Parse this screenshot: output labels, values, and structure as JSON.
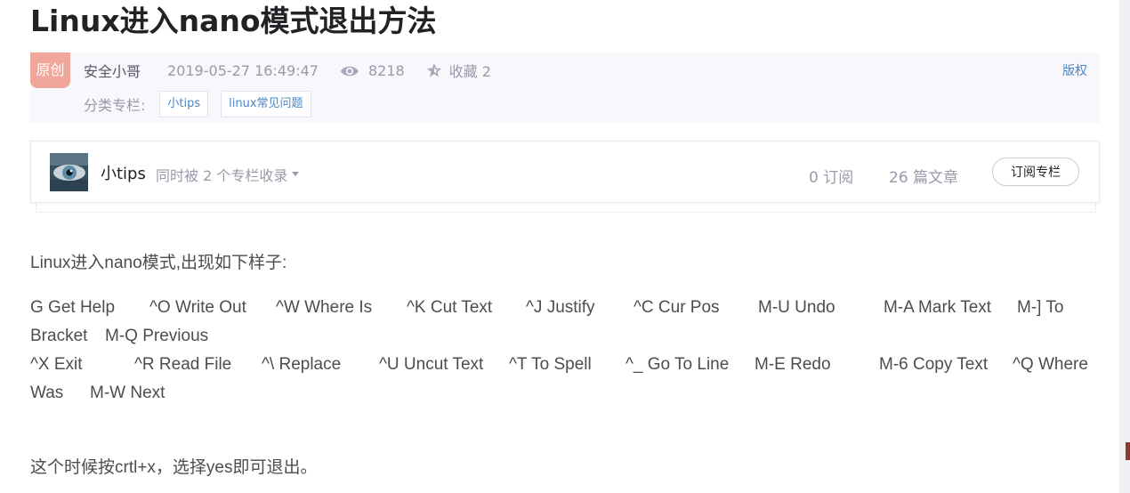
{
  "article": {
    "title": "Linux进入nano模式退出方法",
    "badge": "原创",
    "author": "安全小哥",
    "time": "2019-05-27 16:49:47",
    "views": "8218",
    "favorites": "收藏 2",
    "copyright": "版权",
    "category_label": "分类专栏:",
    "tags": [
      "小tips",
      "linux常见问题"
    ]
  },
  "column": {
    "name": "小tips",
    "included": "同时被 2 个专栏收录",
    "subscribers": "0 订阅",
    "articles": "26 篇文章",
    "subscribe_label": "订阅专栏"
  },
  "content": {
    "intro": "Linux进入nano模式,出现如下样子:",
    "line1": [
      "G Get Help",
      "^O Write Out",
      "^W Where Is",
      "^K Cut Text",
      "^J Justify",
      "^C Cur Pos",
      "M-U Undo",
      "M-A Mark Text",
      "M-] To"
    ],
    "line2": [
      "Bracket",
      "M-Q Previous"
    ],
    "line3": [
      "^X Exit",
      "^R Read File",
      "^\\ Replace",
      "^U Uncut Text",
      "^T To Spell",
      "^_ Go To Line",
      "M-E Redo",
      "M-6 Copy Text",
      "^Q Where"
    ],
    "line4": [
      "Was",
      "M-W Next"
    ],
    "outro": "这个时候按crtl+x，选择yes即可退出。"
  },
  "colors": {
    "badge": "#f0a69a",
    "link": "#4a86c5",
    "meta_bg": "#f7f7fc"
  }
}
